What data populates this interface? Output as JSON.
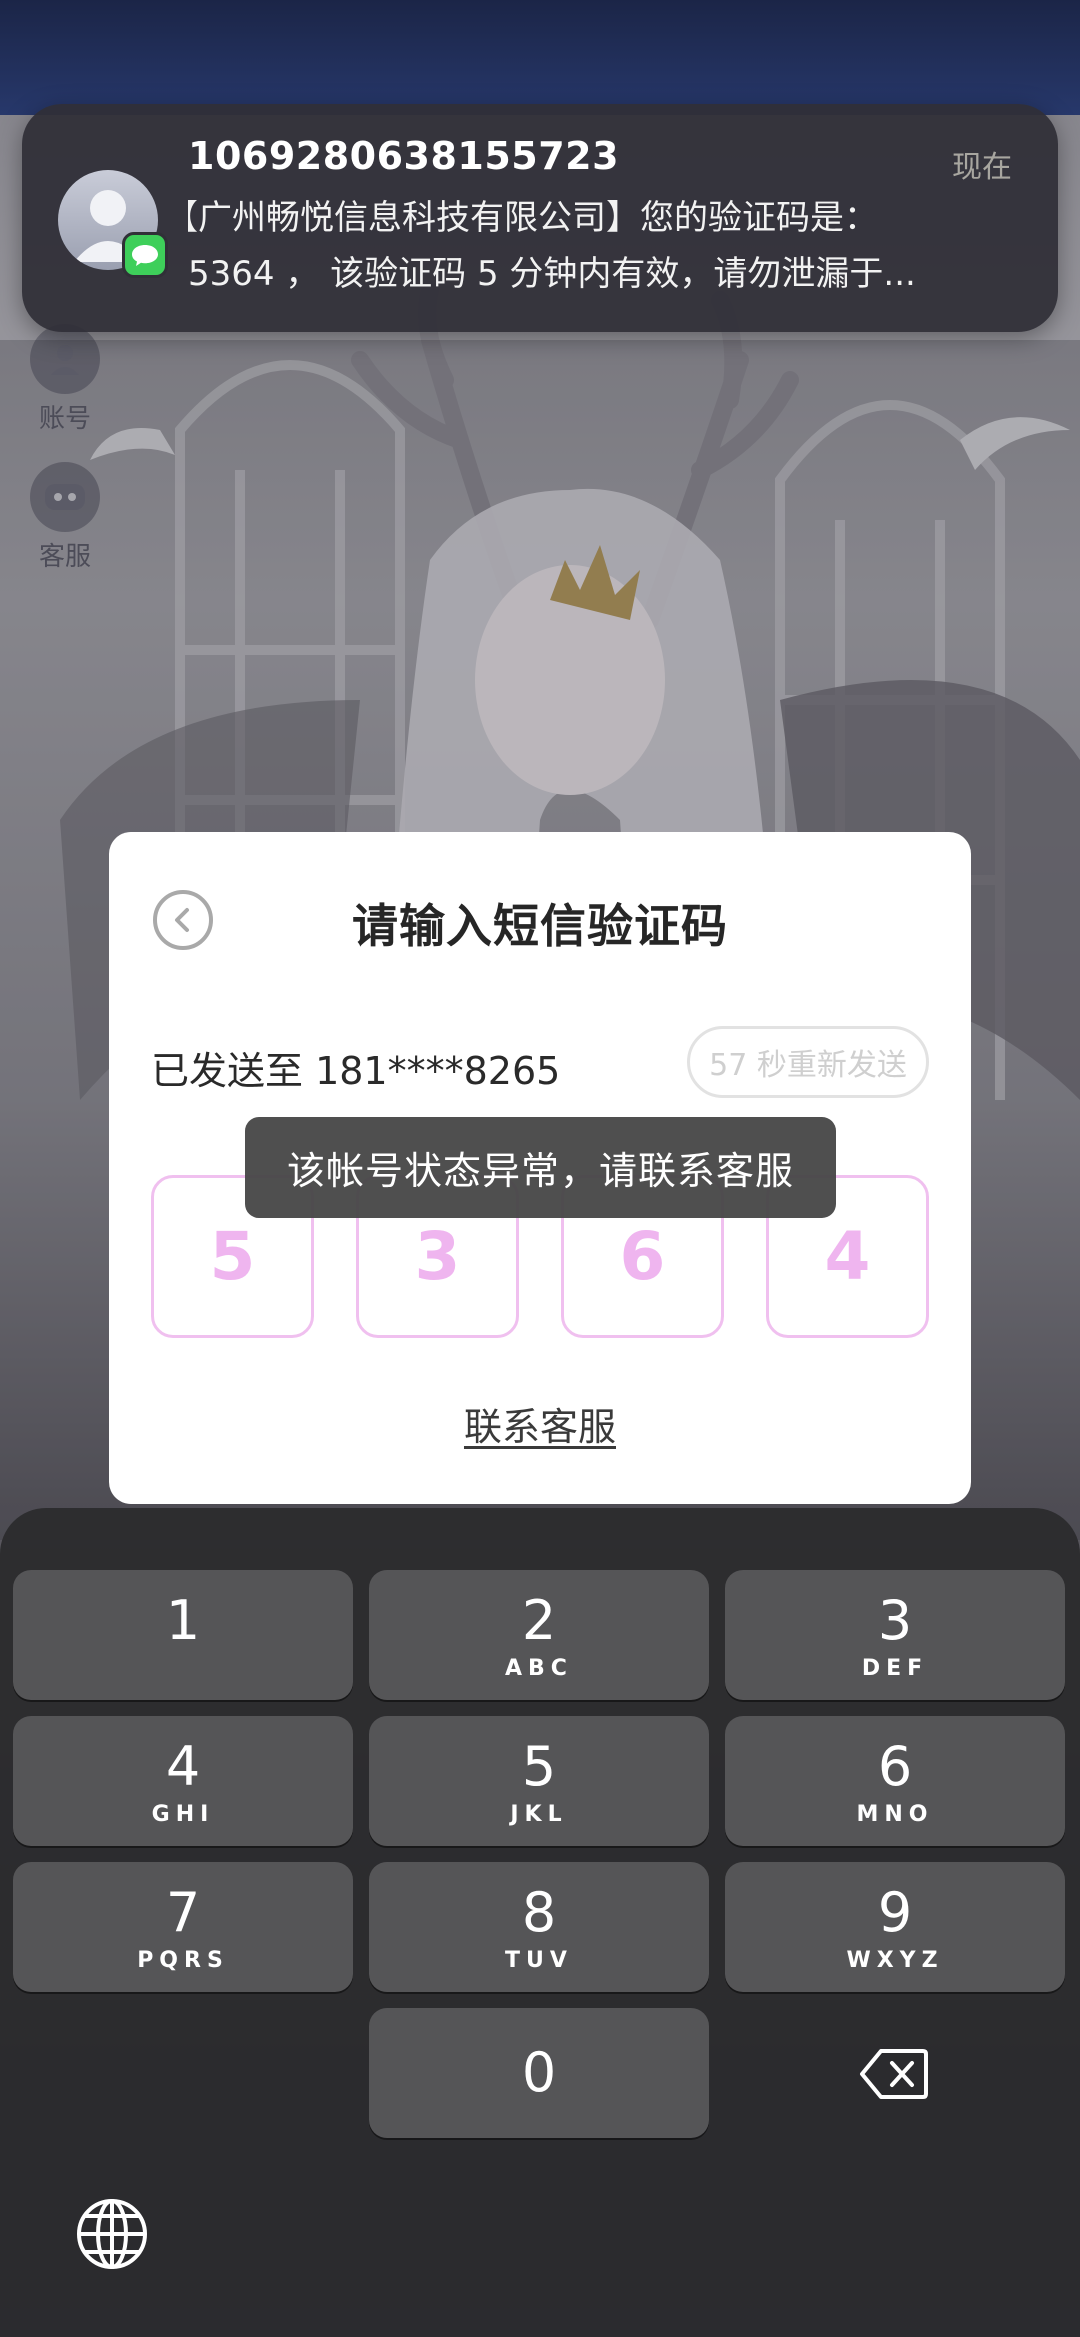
{
  "side_menu": [
    {
      "label": "账号",
      "icon": "account-icon"
    },
    {
      "label": "客服",
      "icon": "customer-service-icon"
    }
  ],
  "notification": {
    "sender": "1069280638155723",
    "time": "现在",
    "line1": "【广州畅悦信息科技有限公司】您的验证码是：",
    "line2": "5364 ， 该验证码 5 分钟内有效，请勿泄漏于..."
  },
  "dialog": {
    "title": "请输入短信验证码",
    "sent_to": "已发送至 181****8265",
    "resend_label": "57 秒重新发送",
    "code_digits": [
      "5",
      "3",
      "6",
      "4"
    ],
    "contact_label": "联系客服",
    "toast": "该帐号状态异常，请联系客服"
  },
  "keypad": {
    "keys": [
      {
        "num": "1",
        "letters": ""
      },
      {
        "num": "2",
        "letters": "ABC"
      },
      {
        "num": "3",
        "letters": "DEF"
      },
      {
        "num": "4",
        "letters": "GHI"
      },
      {
        "num": "5",
        "letters": "JKL"
      },
      {
        "num": "6",
        "letters": "MNO"
      },
      {
        "num": "7",
        "letters": "PQRS"
      },
      {
        "num": "8",
        "letters": "TUV"
      },
      {
        "num": "9",
        "letters": "WXYZ"
      },
      {
        "num": "0",
        "letters": ""
      }
    ]
  },
  "colors": {
    "code_digit": "#efb5ef",
    "code_border": "#f0c0ef",
    "toast_bg": "#464646",
    "notif_badge": "#3ecf5a"
  }
}
